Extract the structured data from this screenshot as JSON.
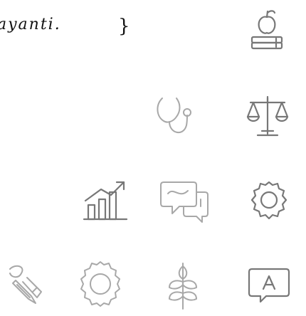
{
  "note": {
    "text": "ayanti.",
    "brace": "}"
  },
  "icons": [
    {
      "name": "book-apple-icon"
    },
    {
      "name": "stethoscope-icon"
    },
    {
      "name": "scale-balance-icon"
    },
    {
      "name": "growth-chart-icon"
    },
    {
      "name": "conversation-icon"
    },
    {
      "name": "settings-gear-icon"
    },
    {
      "name": "pencil-tools-icon"
    },
    {
      "name": "gear-icon"
    },
    {
      "name": "wheat-icon"
    },
    {
      "name": "presentation-icon"
    }
  ]
}
